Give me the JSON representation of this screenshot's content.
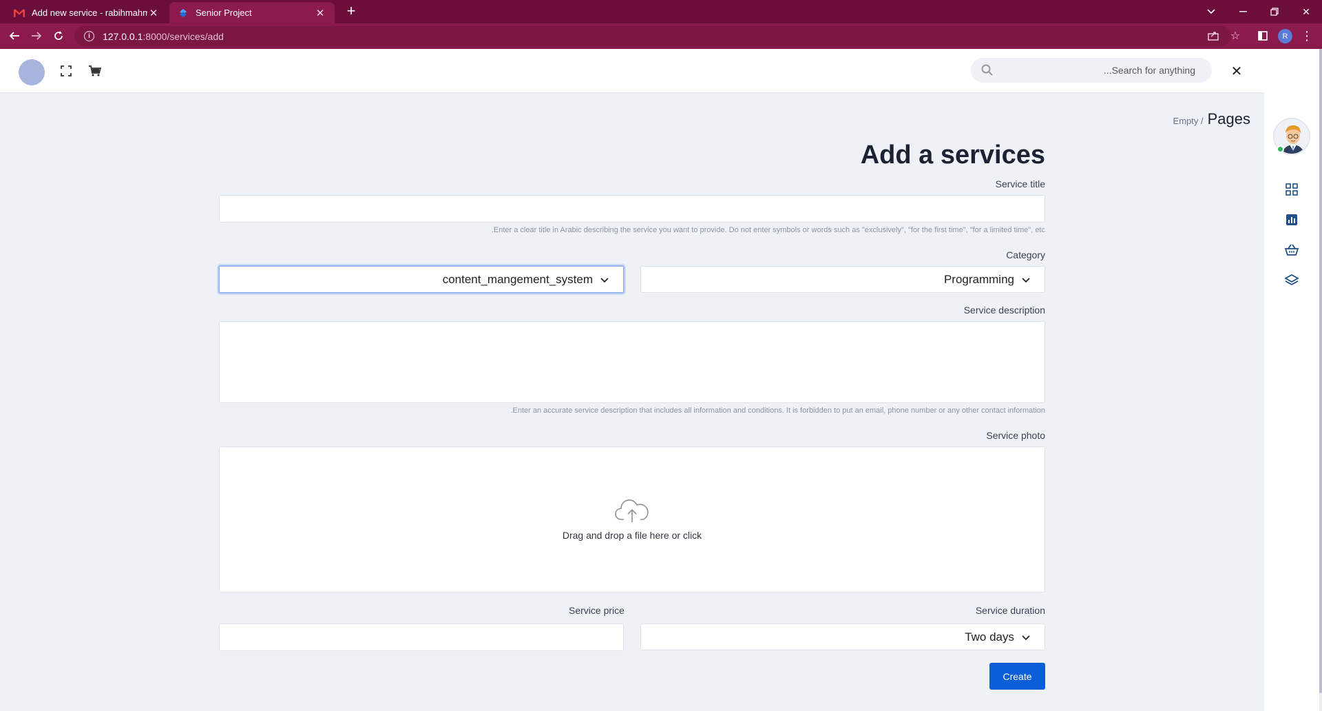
{
  "browser": {
    "tabs": [
      {
        "title": "Add new service - rabihmahmou",
        "favicon": "gmail-icon",
        "active": false
      },
      {
        "title": "Senior Project",
        "favicon": "app-icon",
        "active": true
      }
    ],
    "url_host": "127.0.0.1",
    "url_path": ":8000/services/add",
    "profile_initial": "R"
  },
  "header": {
    "search_placeholder": "...Search for anything"
  },
  "breadcrumb": {
    "parent": "Empty /",
    "current": "Pages"
  },
  "page_title": "Add a services",
  "form": {
    "service_title": {
      "label": "Service title",
      "value": "",
      "hint": ".Enter a clear title in Arabic describing the service you want to provide. Do not enter symbols or words such as \"exclusively\", \"for the first time\", \"for a limited time\", etc"
    },
    "category": {
      "label": "Category",
      "value": "Programming"
    },
    "subcategory": {
      "value": "content_mangement_system"
    },
    "description": {
      "label": "Service description",
      "value": "",
      "hint": ".Enter an accurate service description that includes all information and conditions. It is forbidden to put an email, phone number or any other contact information"
    },
    "photo": {
      "label": "Service photo",
      "dropzone_text": "Drag and drop a file here or click"
    },
    "price": {
      "label": "Service price",
      "value": ""
    },
    "duration": {
      "label": "Service duration",
      "value": "Two days"
    },
    "submit_label": "Create"
  },
  "colors": {
    "tabbar": "#6b0e3a",
    "addressbar": "#8b1a4d",
    "primary_button": "#0b5ed7",
    "page_background": "#eef2f7"
  }
}
